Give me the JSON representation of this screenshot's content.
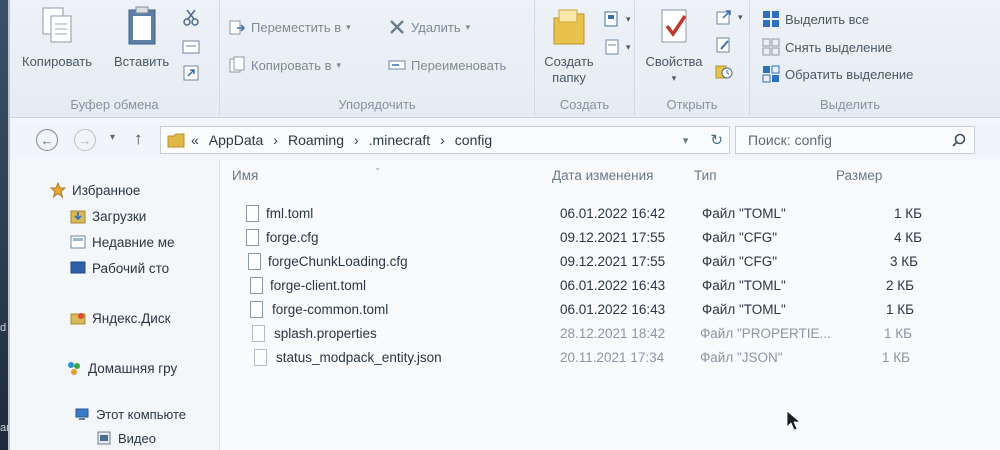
{
  "ribbon": {
    "clipboard": {
      "label": "Буфер обмена",
      "copy": "Копировать",
      "paste": "Вставить"
    },
    "organize": {
      "label": "Упорядочить",
      "move_to": "Переместить в",
      "copy_to": "Копировать в",
      "delete": "Удалить",
      "rename": "Переименовать"
    },
    "new": {
      "label": "Создать",
      "new_folder_line1": "Создать",
      "new_folder_line2": "папку"
    },
    "open": {
      "label": "Открыть",
      "properties": "Свойства"
    },
    "select": {
      "label": "Выделить",
      "select_all": "Выделить все",
      "select_none": "Снять выделение",
      "invert": "Обратить выделение"
    }
  },
  "address": {
    "prefix": "«",
    "crumbs": [
      "AppData",
      "Roaming",
      ".minecraft",
      "config"
    ],
    "separator": "›",
    "search_placeholder": "Поиск: config"
  },
  "nav": {
    "favorites": "Избранное",
    "downloads": "Загрузки",
    "recent": "Недавние ме",
    "desktop": "Рабочий сто",
    "yandex": "Яндекс.Диск",
    "homegroup": "Домашняя гру",
    "computer": "Этот компьюте",
    "video": "Видео"
  },
  "columns": {
    "name": "Имя",
    "date": "Дата изменения",
    "type": "Тип",
    "size": "Размер"
  },
  "files": [
    {
      "name": "fml.toml",
      "date": "06.01.2022 16:42",
      "type": "Файл \"TOML\"",
      "size": "1 КБ"
    },
    {
      "name": "forge.cfg",
      "date": "09.12.2021 17:55",
      "type": "Файл \"CFG\"",
      "size": "4 КБ"
    },
    {
      "name": "forgeChunkLoading.cfg",
      "date": "09.12.2021 17:55",
      "type": "Файл \"CFG\"",
      "size": "3 КБ"
    },
    {
      "name": "forge-client.toml",
      "date": "06.01.2022 16:43",
      "type": "Файл \"TOML\"",
      "size": "2 КБ"
    },
    {
      "name": "forge-common.toml",
      "date": "06.01.2022 16:43",
      "type": "Файл \"TOML\"",
      "size": "1 КБ"
    },
    {
      "name": "splash.properties",
      "date": "28.12.2021 18:42",
      "type": "Файл \"PROPERTIE...",
      "size": "1 КБ"
    },
    {
      "name": "status_modpack_entity.json",
      "date": "20.11.2021 17:34",
      "type": "Файл \"JSON\"",
      "size": "1 КБ"
    }
  ],
  "desktop_edge": {
    "line1": "апка",
    "line2": "d"
  },
  "colors": {
    "accent_blue": "#2f6fbf",
    "folder_yellow": "#e8c24a",
    "delete_red": "#c0392b"
  }
}
